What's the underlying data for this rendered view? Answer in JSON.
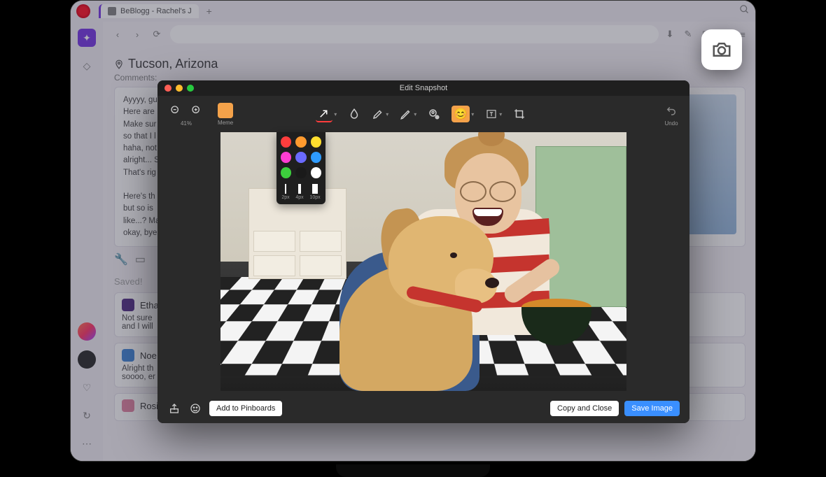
{
  "tab": {
    "title": "BeBlogg - Rachel's J"
  },
  "location": "Tucson, Arizona",
  "comments_label": "Comments:",
  "post_text": "Ayyyy, gu\nHere are\nMake sur\nso that I l\nhaha, not\nalright... S\nThat's rig\n\nHere's th\nbut so is\nlike...? Ma\nokay, bye",
  "saved": "Saved!",
  "cards": [
    {
      "name": "Etha",
      "text": "Not sure\nand I will"
    },
    {
      "name": "Noe",
      "text": "Alright th\nsoooo, er"
    },
    {
      "name": "Rosie",
      "text": ""
    }
  ],
  "modal": {
    "title": "Edit Snapshot",
    "zoom": "41%",
    "meme": "Meme",
    "undo": "Undo",
    "colors": {
      "row1": [
        "#ff3d3d",
        "#ff9a2e",
        "#ffde2e"
      ],
      "row2": [
        "#ff3dd2",
        "#6a6aff",
        "#2e9bff"
      ],
      "row3": [
        "#3dcf3d",
        "#1a1a1a",
        "#ffffff"
      ]
    },
    "thickness": [
      "2px",
      "4px",
      "10px"
    ],
    "footer": {
      "add_pinboards": "Add to Pinboards",
      "copy_close": "Copy and Close",
      "save_image": "Save Image"
    }
  }
}
